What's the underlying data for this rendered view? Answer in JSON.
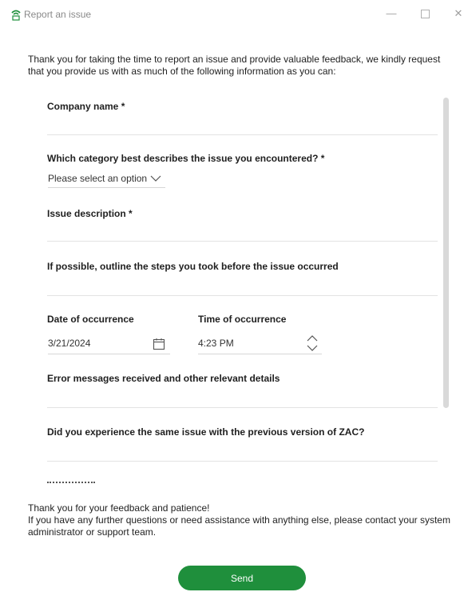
{
  "window": {
    "title": "Report an issue",
    "minimize_glyph": "—",
    "close_glyph": "✕",
    "brand_color": "#1f8f3c"
  },
  "intro_text": "Thank you for taking the time to report an issue and provide valuable feedback, we kindly request that you provide us with as much of the following information as you can:",
  "form": {
    "company_name_label": "Company name *",
    "category_label": "Which category best describes the issue you encountered? *",
    "category_value": "Please select an option",
    "issue_description_label": "Issue description *",
    "steps_label": "If possible, outline the steps you took before the issue occurred",
    "date_label": "Date of occurrence",
    "date_value": "3/21/2024",
    "time_label": "Time of occurrence",
    "time_value": "4:23 PM",
    "error_messages_label": "Error messages received and other relevant details",
    "previous_version_label": "Did you experience the same issue with the previous version of ZAC?"
  },
  "outro": {
    "line1": "Thank you for your feedback and patience!",
    "line2": "If you have any further questions or need assistance with anything else, please contact your system administrator or support team."
  },
  "send_label": "Send",
  "icons": {
    "app": "app-logo-icon",
    "dropdown": "chevron-down-icon",
    "date": "calendar-icon",
    "time": "spinner-updown-icon"
  }
}
